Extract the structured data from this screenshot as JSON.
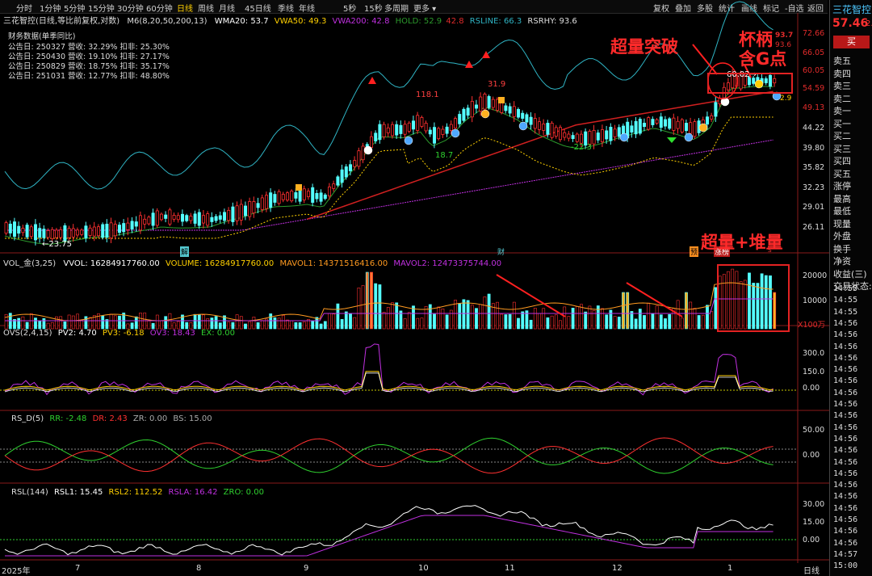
{
  "app_title": "三花智控",
  "price": {
    "last": "57.46",
    "change_partial": "2."
  },
  "buy_button": "买",
  "toolbar": {
    "periods": [
      "分时",
      "1分钟",
      "5分钟",
      "15分钟",
      "30分钟",
      "60分钟",
      "日线",
      "周线",
      "月线",
      "45日线",
      "季线",
      "年线",
      "5秒",
      "15秒",
      "多周期",
      "更多"
    ],
    "active_period": "日线",
    "right_items": [
      "复权",
      "叠加",
      "多股",
      "统计",
      "画线",
      "标记",
      "-自选",
      "返回"
    ]
  },
  "main_legend": {
    "title": "三花智控(日线,等比前复权,对数)",
    "ma": "M6(8,20,50,200,13)",
    "wma20": "WMA20: 53.7",
    "vwa50": "VWA50: 49.3",
    "vwa200": "VWA200: 42.8",
    "hold": "HOLD: 52.9",
    "hold2": "42.8",
    "rsline": "RSLINE: 66.3",
    "rsrhy": "RSRHY: 93.6"
  },
  "financial": {
    "header": "财务数据(单季同比)",
    "rows": [
      "公告日: 250327   营收: 32.29%   扣非: 25.30%",
      "公告日: 250430   营收: 19.10%   扣非: 27.17%",
      "公告日: 250829   营收: 18.75%   扣非: 35.17%",
      "公告日: 251031   营收: 12.77%   扣非: 48.80%"
    ]
  },
  "price_scale": [
    "72.66",
    "66.05",
    "60.05",
    "54.59",
    "49.13",
    "44.22",
    "39.80",
    "35.82",
    "32.23",
    "29.01",
    "26.11"
  ],
  "price_labels": {
    "low": "←23.75",
    "p118": "118.1",
    "p31": "31.9",
    "p18": "18.7",
    "p22": "-22.3",
    "p60": "60.02→",
    "p937": "93.7",
    "p936": "93.6",
    "p29": "2.9"
  },
  "event_markers": {
    "jie": "解",
    "cai": "财",
    "yu": "预",
    "zhangbang": "涨榜",
    "s": "s"
  },
  "annotations": {
    "breakout": "超量突破",
    "cup": "杯柄",
    "g_point": "含G点",
    "volume": "超量+堆量"
  },
  "volume_legend": {
    "name": "VOL_金(3,25)",
    "vvol": "VVOL: 16284917760.00",
    "volume": "VOLUME: 16284917760.00",
    "mavol1": "MAVOL1: 14371516416.00",
    "mavol2": "MAVOL2: 12473375744.00"
  },
  "volume_scale": [
    "20000",
    "10000"
  ],
  "volume_unit": "X100万",
  "ovs_legend": {
    "name": "OVS(2,4,15)",
    "pv2": "PV2: 4.70",
    "pv3": "PV3: -6.18",
    "ov3": "OV3: 18.43",
    "ex": "EX: 0.00"
  },
  "ovs_scale": [
    "300.0",
    "150.0",
    "0.00"
  ],
  "rsd_legend": {
    "name": "RS_D(5)",
    "rr": "RR: -2.48",
    "dr": "DR: 2.43",
    "zr": "ZR: 0.00",
    "bs": "BS: 15.00"
  },
  "rsd_scale": [
    "50.00",
    "0.00"
  ],
  "rsl_legend": {
    "name": "RSL(144)",
    "rsl1": "RSL1: 15.45",
    "rsl2": "RSL2: 112.52",
    "rsla": "RSLA: 16.42",
    "zro": "ZRO: 0.00"
  },
  "rsl_scale": [
    "30.00",
    "15.00",
    "0.00"
  ],
  "x_axis": [
    "2025年",
    "7",
    "8",
    "9",
    "10",
    "11",
    "12",
    "1"
  ],
  "x_axis_right": "日线",
  "order_book": [
    "卖五",
    "卖四",
    "卖三",
    "卖二",
    "卖一",
    "买一",
    "买二",
    "买三",
    "买四",
    "买五"
  ],
  "stats": [
    "涨停",
    "最高",
    "最低",
    "现量",
    "外盘",
    "换手",
    "净资",
    "收益(三)"
  ],
  "trade_status": "交易状态:",
  "tick_times": [
    "14:55",
    "14:55",
    "14:55",
    "14:56",
    "14:56",
    "14:56",
    "14:56",
    "14:56",
    "14:56",
    "14:56",
    "14:56",
    "14:56",
    "14:56",
    "14:56",
    "14:56",
    "14:56",
    "14:56",
    "14:56",
    "14:56",
    "14:56",
    "14:56",
    "14:56",
    "14:56",
    "14:57",
    "15:00"
  ],
  "colors": {
    "up": "#ff3030",
    "down": "#54ffff",
    "ma_white": "#ffffff",
    "vwa50": "#ffd000",
    "vwa200": "#c030e0",
    "rsline": "#2fb4c4",
    "hold": "#2c9a2c",
    "annotation": "#ff2a2a"
  }
}
